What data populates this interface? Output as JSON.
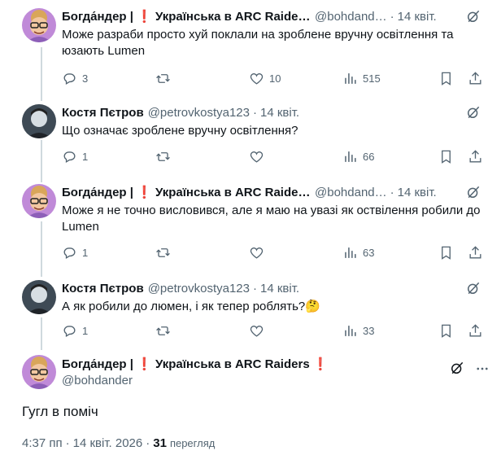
{
  "tweets": [
    {
      "name": "Богда́ндер | ❗ Українська в ARC Raiders…",
      "handle": "@bohdand…",
      "date": "14 квіт.",
      "text": "Може разраби просто хуй поклали на зроблене вручну освітлення та юзають Lumen",
      "replies": "3",
      "retweets": "",
      "likes": "10",
      "views": "515"
    },
    {
      "name": "Костя Пєтров",
      "handle": "@petrovkostya123",
      "date": "14 квіт.",
      "text": "Що означає зроблене вручну освітлення?",
      "replies": "1",
      "retweets": "",
      "likes": "",
      "views": "66"
    },
    {
      "name": "Богда́ндер | ❗ Українська в ARC Raiders…",
      "handle": "@bohdand…",
      "date": "14 квіт.",
      "text": "Може я не точно висловився, але я маю на увазі як оствілення робили до Lumen",
      "replies": "1",
      "retweets": "",
      "likes": "",
      "views": "63"
    },
    {
      "name": "Костя Пєтров",
      "handle": "@petrovkostya123",
      "date": "14 квіт.",
      "text": "А як робили до люмен, і як тепер роблять?🤔",
      "replies": "1",
      "retweets": "",
      "likes": "",
      "views": "33"
    }
  ],
  "main": {
    "name": "Богда́ндер | ❗ Українська в ARC Raiders ❗",
    "handle": "@bohdander",
    "text": "Гугл в поміч",
    "time": "4:37 пп",
    "date": "14 квіт. 2026",
    "views_count": "31",
    "views_label": "перегляд"
  }
}
